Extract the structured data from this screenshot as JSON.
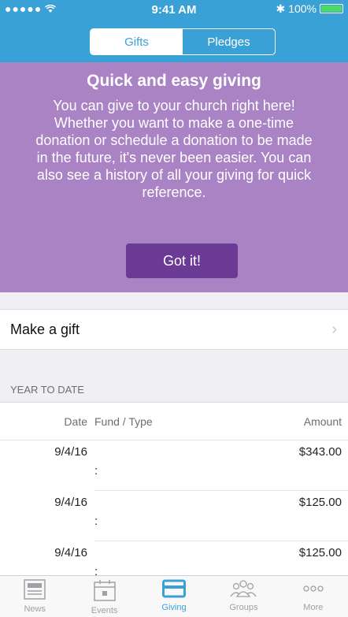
{
  "status_bar": {
    "signal": "●●●●●",
    "time": "9:41 AM",
    "battery_pct": "100%"
  },
  "segments": {
    "gifts": "Gifts",
    "pledges": "Pledges"
  },
  "promo": {
    "title": "Quick and easy giving",
    "lines": [
      "You can give to your church right here!",
      "Whether you want to make a one-time",
      "donation or schedule a donation to be made",
      "in the future, it's never been easier. You can",
      "also see a history of all your giving for quick",
      "reference."
    ],
    "button": "Got it!"
  },
  "make_gift": {
    "label": "Make a gift"
  },
  "section": {
    "header": "YEAR TO DATE"
  },
  "table": {
    "col_date": "Date",
    "col_fund": "Fund / Type",
    "col_amount": "Amount",
    "rows": [
      {
        "date": "9/4/16",
        "fund": ":",
        "amount": "$343.00"
      },
      {
        "date": "9/4/16",
        "fund": ":",
        "amount": "$125.00"
      },
      {
        "date": "9/4/16",
        "fund": ":",
        "amount": "$125.00"
      }
    ]
  },
  "tabbar": {
    "news": "News",
    "events": "Events",
    "giving": "Giving",
    "groups": "Groups",
    "more": "More"
  },
  "colors": {
    "accent": "#3aa1d6",
    "promo_bg": "#a983c4",
    "button_bg": "#6b3a95"
  }
}
